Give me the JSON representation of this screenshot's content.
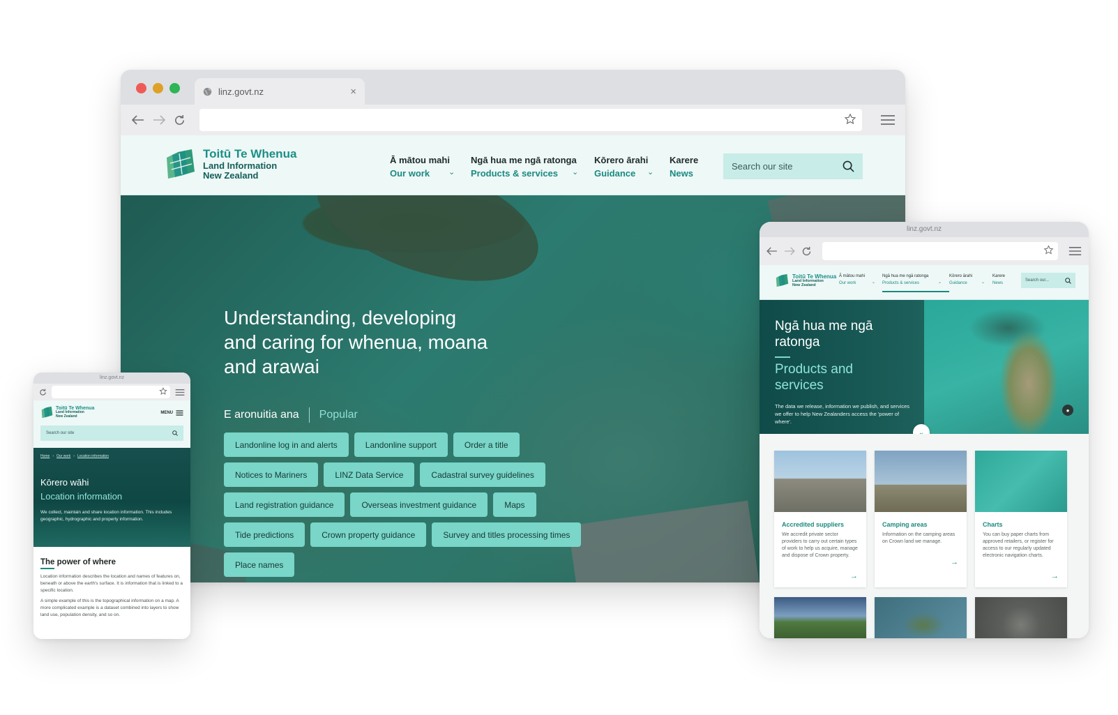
{
  "colors": {
    "accent": "#1a8a80",
    "chip": "#79d6c8",
    "header_bg": "#eef8f7",
    "search_bg": "#c8ece8",
    "mac_red": "#ee5b57",
    "mac_yellow": "#dea126",
    "mac_green": "#2fb456"
  },
  "logo": {
    "line1": "Toitū Te Whenua",
    "line2": "Land Information",
    "line3": "New Zealand"
  },
  "desktop": {
    "tab_title": "linz.govt.nz",
    "tab_icon": "globe-icon",
    "nav": [
      {
        "mi": "Ā mātou mahi",
        "en": "Our work"
      },
      {
        "mi": "Ngā hua me ngā ratonga",
        "en": "Products & services"
      },
      {
        "mi": "Kōrero ārahi",
        "en": "Guidance"
      },
      {
        "mi": "Karere",
        "en": "News"
      }
    ],
    "search_placeholder": "Search our site",
    "hero_title": "Understanding, developing and caring for whenua, moana and arawai",
    "popular_mi": "E aronuitia ana",
    "popular_en": "Popular",
    "chips": [
      "Landonline log in and alerts",
      "Landonline support",
      "Order a title",
      "Notices to Mariners",
      "LINZ Data Service",
      "Cadastral survey guidelines",
      "Land registration guidance",
      "Overseas investment guidance",
      "Maps",
      "Tide predictions",
      "Crown property guidance",
      "Survey and titles processing times",
      "Place names"
    ]
  },
  "tablet": {
    "url": "linz.govt.nz",
    "nav": [
      {
        "mi": "Ā mātou mahi",
        "en": "Our work"
      },
      {
        "mi": "Ngā hua me ngā ratonga",
        "en": "Products & services"
      },
      {
        "mi": "Kōrero ārahi",
        "en": "Guidance"
      },
      {
        "mi": "Karere",
        "en": "News"
      }
    ],
    "search_placeholder": "Search our...",
    "hero_mi": "Ngā hua me ngā ratonga",
    "hero_en": "Products and services",
    "hero_desc": "The data we release, information we publish, and services we offer to help New Zealanders access the 'power of where'.",
    "cards": [
      {
        "title": "Accredited suppliers",
        "desc": "We accredit private sector providers to carry out certain types of work to help us acquire, manage and dispose of Crown property."
      },
      {
        "title": "Camping areas",
        "desc": "Information on the camping areas on Crown land we manage."
      },
      {
        "title": "Charts",
        "desc": "You can buy paper charts from approved retailers, or register for access to our regularly updated electronic navigation charts."
      }
    ]
  },
  "mobile": {
    "url": "linz.govt.nz",
    "menu_label": "MENU",
    "search_placeholder": "Search our site",
    "breadcrumbs": [
      "Home",
      "Our work",
      "Location information"
    ],
    "hero_mi": "Kōrero wāhi",
    "hero_en": "Location information",
    "hero_desc": "We collect, maintain and share location information. This includes geographic, hydrographic and property information.",
    "section_title": "The power of where",
    "para1": "Location information describes the location and names of features on, beneath or above the earth's surface. It is information that is linked to a specific location.",
    "para2": "A simple example of this is the topographical information on a map. A more complicated example is a dataset combined into layers to show land use, population density, and so on."
  }
}
